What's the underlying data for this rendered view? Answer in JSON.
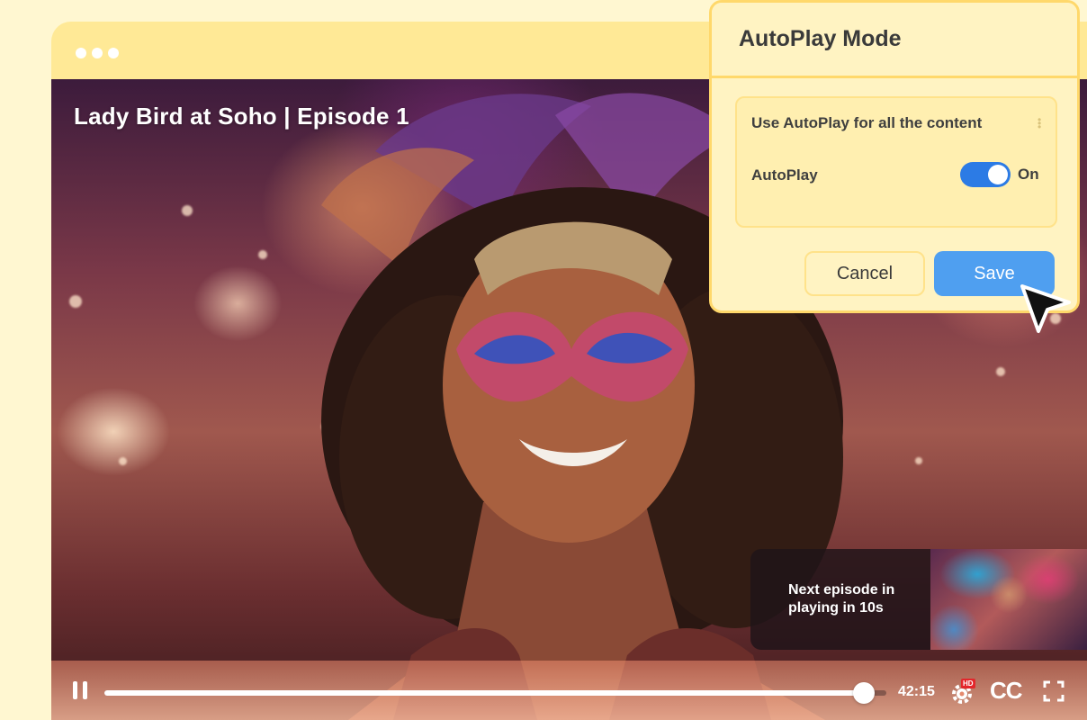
{
  "window": {
    "controls_icon": "window-dots-icon"
  },
  "video": {
    "title": "Lady Bird at Soho | Episode 1",
    "next_episode": {
      "text_line1": "Next episode in",
      "text_line2": "playing in 10s"
    },
    "controls": {
      "time": "42:15",
      "progress": 0.97,
      "hd_badge": "HD",
      "cc_label": "CC"
    }
  },
  "dialog": {
    "title": "AutoPlay Mode",
    "heading": "Use AutoPlay for all the content",
    "autoplay_label": "AutoPlay",
    "toggle_state": "On",
    "cancel_label": "Cancel",
    "save_label": "Save"
  },
  "colors": {
    "accent": "#2c7be5",
    "save_button": "#4f9ff0",
    "dialog_bg": "#fff3c2",
    "dialog_border": "#ffd86b",
    "hd_badge": "#e3262b"
  }
}
